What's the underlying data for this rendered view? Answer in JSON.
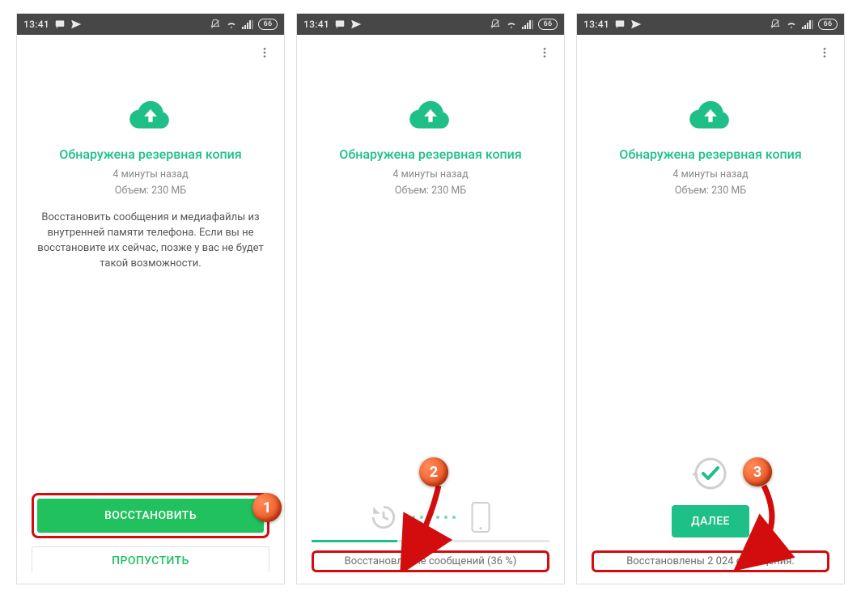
{
  "status_bar": {
    "time": "13:41",
    "battery": "66"
  },
  "common": {
    "title": "Обнаружена резервная копия",
    "backup_age": "4 минуты назад",
    "backup_size": "Объем: 230 МБ"
  },
  "screen1": {
    "description": "Восстановить сообщения и медиафайлы из внутренней памяти телефона. Если вы не восстановите их сейчас, позже у вас не будет такой возможности.",
    "restore_label": "ВОССТАНОВИТЬ",
    "skip_label": "ПРОПУСТИТЬ"
  },
  "screen2": {
    "progress_label": "Восстановление сообщений (36 %)",
    "progress_percent": 36
  },
  "screen3": {
    "next_label": "ДАЛЕЕ",
    "done_label": "Восстановлены 2 024 сообщения."
  },
  "annotations": {
    "badge1": "1",
    "badge2": "2",
    "badge3": "3"
  }
}
